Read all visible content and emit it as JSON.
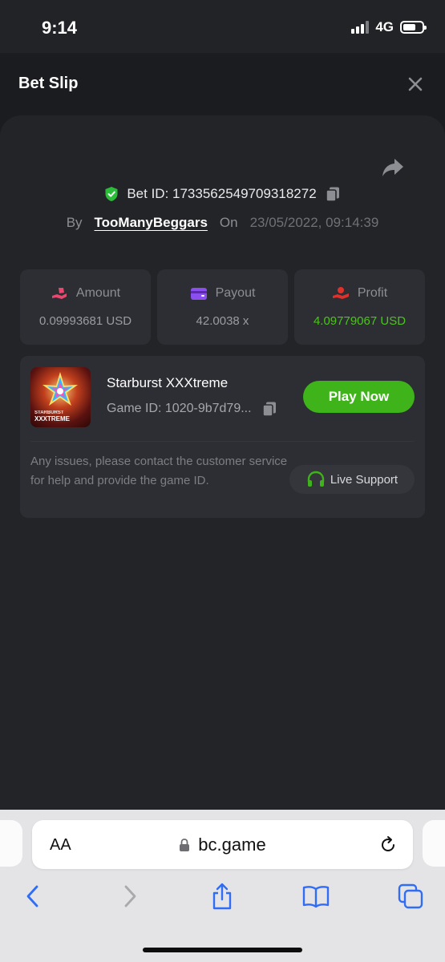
{
  "status_bar": {
    "time": "9:14",
    "network": "4G"
  },
  "header": {
    "title": "Bet Slip"
  },
  "bet": {
    "bet_id_text": "Bet ID: 1733562549709318272",
    "by_label": "By",
    "username": "TooManyBeggars",
    "on_label": "On",
    "datetime": "23/05/2022, 09:14:39"
  },
  "stats": [
    {
      "label": "Amount",
      "value": "0.09993681 USD",
      "icon": "amount-hand-icon",
      "color": "#e8476e"
    },
    {
      "label": "Payout",
      "value": "42.0038 x",
      "icon": "wallet-icon",
      "color": "#8b4ff0"
    },
    {
      "label": "Profit",
      "value": "4.09779067 USD",
      "icon": "profit-hand-icon",
      "color": "#e0302a"
    }
  ],
  "game": {
    "title": "Starburst XXXtreme",
    "game_id": "Game ID: 1020-9b7d79...",
    "thumb_line1": "STARBURST",
    "thumb_line2": "XXXTREME",
    "play_label": "Play Now",
    "issues_text": "Any issues, please contact the customer service for help and provide the game ID.",
    "support_label": "Live Support"
  },
  "browser": {
    "aa_label": "AA",
    "url": "bc.game"
  },
  "colors": {
    "accent_green": "#3fb31a",
    "profit_green": "#4cc418",
    "shield_green": "#2bbd3a"
  }
}
